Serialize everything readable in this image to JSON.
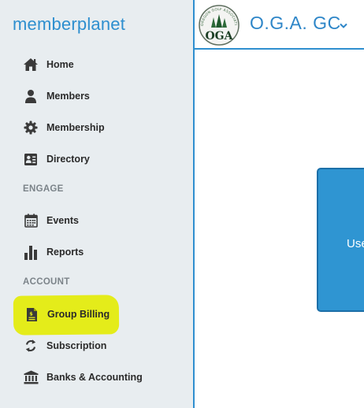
{
  "brand": {
    "logo_text": "memberplanet"
  },
  "org": {
    "name": "O.G.A. GC",
    "logo_arc_text": "OREGON GOLF ASSOCIATION",
    "logo_letters": "OGA"
  },
  "sidebar": {
    "items": [
      {
        "label": "Home",
        "icon": "home-icon"
      },
      {
        "label": "Members",
        "icon": "person-icon"
      },
      {
        "label": "Membership",
        "icon": "gear-icon"
      },
      {
        "label": "Directory",
        "icon": "contact-card-icon"
      }
    ],
    "sections": [
      {
        "label": "ENGAGE",
        "items": [
          {
            "label": "Events",
            "icon": "calendar-icon"
          },
          {
            "label": "Reports",
            "icon": "bar-chart-icon"
          }
        ]
      },
      {
        "label": "ACCOUNT",
        "items": [
          {
            "label": "Group Billing",
            "icon": "invoice-icon",
            "highlighted": true
          },
          {
            "label": "Subscription",
            "icon": "refresh-icon"
          },
          {
            "label": "Banks & Accounting",
            "icon": "bank-icon"
          }
        ]
      }
    ]
  },
  "main": {
    "card_text": "Use"
  },
  "colors": {
    "accent": "#2e8fcf",
    "sidebar_bg": "#e8edf0",
    "highlight": "#e4ec1a",
    "card_bg": "#2f95d2"
  }
}
